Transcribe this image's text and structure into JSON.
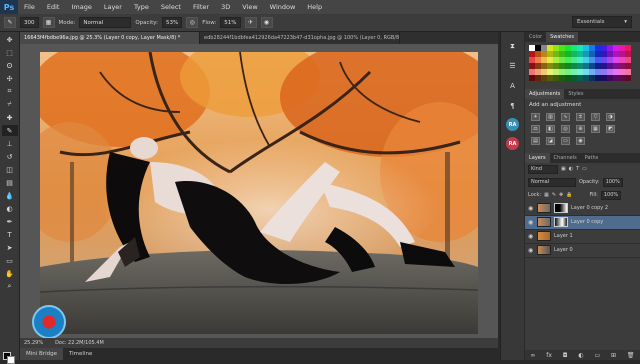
{
  "app": {
    "logo": "Ps"
  },
  "menu": [
    "File",
    "Edit",
    "Image",
    "Layer",
    "Type",
    "Select",
    "Filter",
    "3D",
    "View",
    "Window",
    "Help"
  ],
  "options": {
    "brush_size": "300",
    "mode_label": "Mode:",
    "mode_value": "Normal",
    "opacity_label": "Opacity:",
    "opacity_value": "53%",
    "flow_label": "Flow:",
    "flow_value": "51%",
    "workspace": "Essentials"
  },
  "tabs": [
    {
      "label": "16643f4fbdbe96a.jpg @ 25.3% (Layer 0 copy, Layer Mask/8) *",
      "active": true
    },
    {
      "label": "edb28244f1bdbfea412926da47223b47-d31opha.jpg @ 100% (Layer 0, RGB/8) *",
      "active": false
    }
  ],
  "status": {
    "zoom": "25.29%",
    "doc": "Doc: 22.2M/105.4M"
  },
  "bottom_tabs": [
    "Mini Bridge",
    "Timeline"
  ],
  "mini_badges": [
    {
      "label": "RA",
      "color": "#3b8fb5"
    },
    {
      "label": "RA",
      "color": "#c53b4d"
    }
  ],
  "color_panel": {
    "tabs": [
      "Color",
      "Swatches"
    ]
  },
  "adjustments": {
    "tabs": [
      "Adjustments",
      "Styles"
    ],
    "title": "Add an adjustment"
  },
  "layers": {
    "tabs": [
      "Layers",
      "Channels",
      "Paths"
    ],
    "kind_label": "Kind",
    "blend_mode": "Normal",
    "opacity_label": "Opacity:",
    "opacity_value": "100%",
    "lock_label": "Lock:",
    "fill_label": "Fill:",
    "fill_value": "100%",
    "items": [
      {
        "name": "Layer 0 copy 2",
        "selected": false,
        "has_mask": true
      },
      {
        "name": "Layer 0 copy",
        "selected": true,
        "has_mask": true
      },
      {
        "name": "Layer 1",
        "selected": false,
        "has_mask": false
      },
      {
        "name": "Layer 0",
        "selected": false,
        "has_mask": false
      }
    ]
  }
}
